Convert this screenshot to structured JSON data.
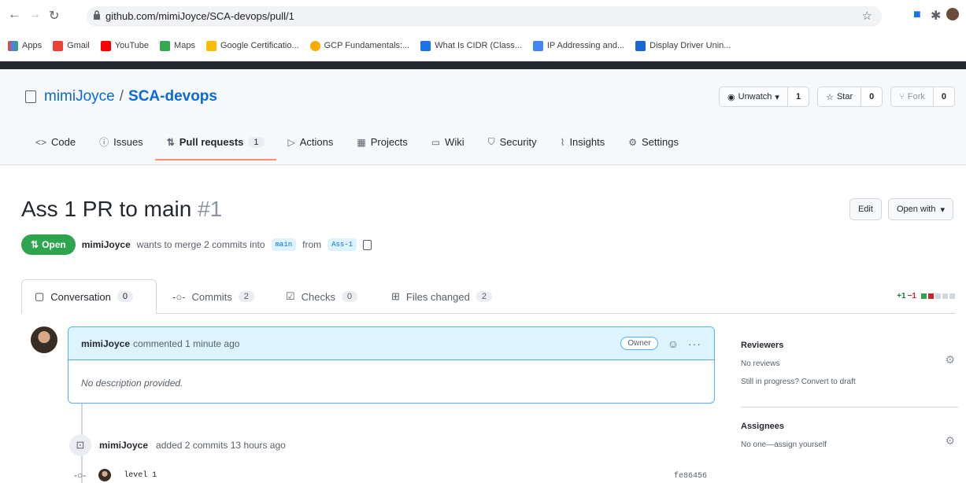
{
  "browser": {
    "url": "github.com/mimiJoyce/SCA-devops/pull/1",
    "bookmarks": [
      {
        "label": "Apps",
        "color": "#ea4335"
      },
      {
        "label": "Gmail",
        "color": "#ea4335"
      },
      {
        "label": "YouTube",
        "color": "#ff0000"
      },
      {
        "label": "Maps",
        "color": "#34a853"
      },
      {
        "label": "Google Certificatio...",
        "color": "#fbbc04"
      },
      {
        "label": "GCP Fundamentals:...",
        "color": "#f9ab00"
      },
      {
        "label": "What Is CIDR (Class...",
        "color": "#1a73e8"
      },
      {
        "label": "IP Addressing and...",
        "color": "#4285f4"
      },
      {
        "label": "Display Driver Unin...",
        "color": "#1967d2"
      }
    ]
  },
  "repo": {
    "owner": "mimiJoyce",
    "name": "SCA-devops",
    "watch": {
      "label": "Unwatch",
      "count": "1"
    },
    "star": {
      "label": "Star",
      "count": "0"
    },
    "fork": {
      "label": "Fork",
      "count": "0"
    },
    "tabs": [
      {
        "icon": "<>",
        "label": "Code",
        "count": ""
      },
      {
        "icon": "ⓘ",
        "label": "Issues",
        "count": ""
      },
      {
        "icon": "⇅",
        "label": "Pull requests",
        "count": "1"
      },
      {
        "icon": "▷",
        "label": "Actions",
        "count": ""
      },
      {
        "icon": "▦",
        "label": "Projects",
        "count": ""
      },
      {
        "icon": "▭",
        "label": "Wiki",
        "count": ""
      },
      {
        "icon": "⛉",
        "label": "Security",
        "count": ""
      },
      {
        "icon": "⌇",
        "label": "Insights",
        "count": ""
      },
      {
        "icon": "⚙",
        "label": "Settings",
        "count": ""
      }
    ]
  },
  "pr": {
    "title": "Ass 1 PR to main",
    "number": "#1",
    "edit_label": "Edit",
    "open_with_label": "Open with",
    "state": "Open",
    "author": "mimiJoyce",
    "merge_text": "wants to merge 2 commits into",
    "base_branch": "main",
    "from_text": "from",
    "head_branch": "Ass-1",
    "tabs": [
      {
        "label": "Conversation",
        "count": "0"
      },
      {
        "label": "Commits",
        "count": "2"
      },
      {
        "label": "Checks",
        "count": "0"
      },
      {
        "label": "Files changed",
        "count": "2"
      }
    ],
    "diff_add": "+1",
    "diff_del": "−1"
  },
  "comment": {
    "author": "mimiJoyce",
    "action": "commented 1 minute ago",
    "badge": "Owner",
    "body": "No description provided."
  },
  "commit_event": {
    "author": "mimiJoyce",
    "action": "added 2 commits 13 hours ago",
    "commit_message": "level 1",
    "commit_sha": "fe86456"
  },
  "sidebar": {
    "reviewers_title": "Reviewers",
    "reviewers_value": "No reviews",
    "reviewers_hint": "Still in progress? Convert to draft",
    "assignees_title": "Assignees",
    "assignees_value": "No one—assign yourself"
  },
  "colors": {
    "accent": "#0969da",
    "open": "#2da44e",
    "tab_underline": "#fd8c73"
  }
}
